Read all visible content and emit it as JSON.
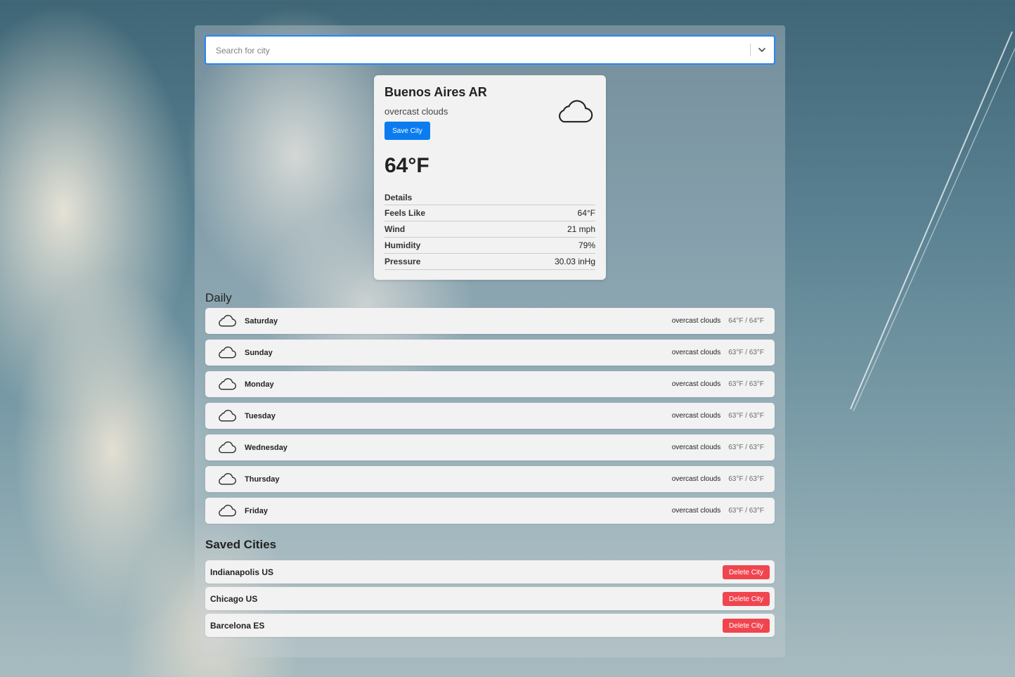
{
  "search": {
    "placeholder": "Search for city"
  },
  "current": {
    "city": "Buenos Aires AR",
    "description": "overcast clouds",
    "save_label": "Save City",
    "icon": "cloud-icon",
    "temperature": "64°F",
    "details_heading": "Details",
    "details": [
      {
        "label": "Feels Like",
        "value": "64°F"
      },
      {
        "label": "Wind",
        "value": "21 mph"
      },
      {
        "label": "Humidity",
        "value": "79%"
      },
      {
        "label": "Pressure",
        "value": "30.03 inHg"
      }
    ]
  },
  "daily": {
    "heading": "Daily",
    "days": [
      {
        "name": "Saturday",
        "description": "overcast clouds",
        "temps": "64°F / 64°F",
        "icon": "cloud-icon"
      },
      {
        "name": "Sunday",
        "description": "overcast clouds",
        "temps": "63°F / 63°F",
        "icon": "cloud-icon"
      },
      {
        "name": "Monday",
        "description": "overcast clouds",
        "temps": "63°F / 63°F",
        "icon": "cloud-icon"
      },
      {
        "name": "Tuesday",
        "description": "overcast clouds",
        "temps": "63°F / 63°F",
        "icon": "cloud-icon"
      },
      {
        "name": "Wednesday",
        "description": "overcast clouds",
        "temps": "63°F / 63°F",
        "icon": "cloud-icon"
      },
      {
        "name": "Thursday",
        "description": "overcast clouds",
        "temps": "63°F / 63°F",
        "icon": "cloud-icon"
      },
      {
        "name": "Friday",
        "description": "overcast clouds",
        "temps": "63°F / 63°F",
        "icon": "cloud-icon"
      }
    ]
  },
  "saved": {
    "heading": "Saved Cities",
    "delete_label": "Delete City",
    "cities": [
      "Indianapolis US",
      "Chicago US",
      "Barcelona ES"
    ]
  },
  "colors": {
    "accent": "#0a7cf0",
    "danger": "#f0454f",
    "focus": "#2684ff"
  }
}
